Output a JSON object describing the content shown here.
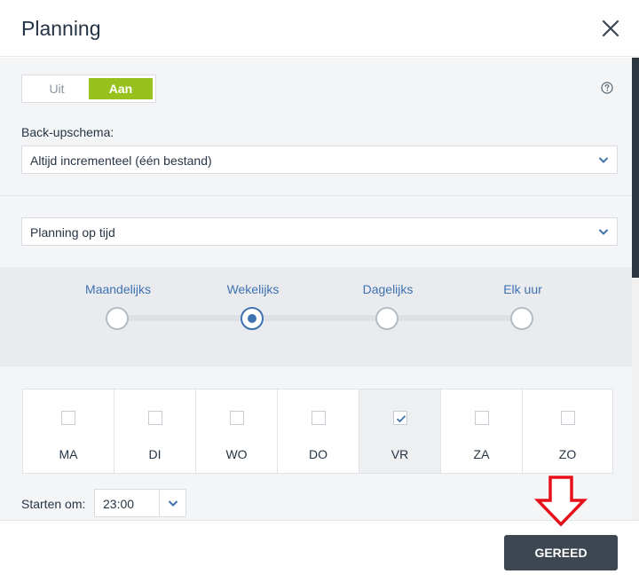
{
  "dialog": {
    "title": "Planning"
  },
  "toggle": {
    "off_label": "Uit",
    "on_label": "Aan",
    "active": "on",
    "active_color": "#97c21e"
  },
  "icons": {
    "close": "close-icon",
    "help": "help-icon",
    "chevron": "chevron-down-icon",
    "check": "check-icon",
    "annotation": "down-arrow-annotation-icon"
  },
  "schema": {
    "label": "Back-upschema:",
    "value": "Altijd incrementeel (één bestand)"
  },
  "planning_type": {
    "value": "Planning op tijd"
  },
  "frequency": {
    "options": [
      "Maandelijks",
      "Wekelijks",
      "Dagelijks",
      "Elk uur"
    ],
    "selected": "Wekelijks",
    "accent": "#3f72b0"
  },
  "days": [
    {
      "label": "MA",
      "checked": false
    },
    {
      "label": "DI",
      "checked": false
    },
    {
      "label": "WO",
      "checked": false
    },
    {
      "label": "DO",
      "checked": false
    },
    {
      "label": "VR",
      "checked": true
    },
    {
      "label": "ZA",
      "checked": false
    },
    {
      "label": "ZO",
      "checked": false
    }
  ],
  "start": {
    "label": "Starten om:",
    "time": "23:00"
  },
  "footer": {
    "done_label": "GEREED",
    "annotation_color": "#e5101a"
  }
}
